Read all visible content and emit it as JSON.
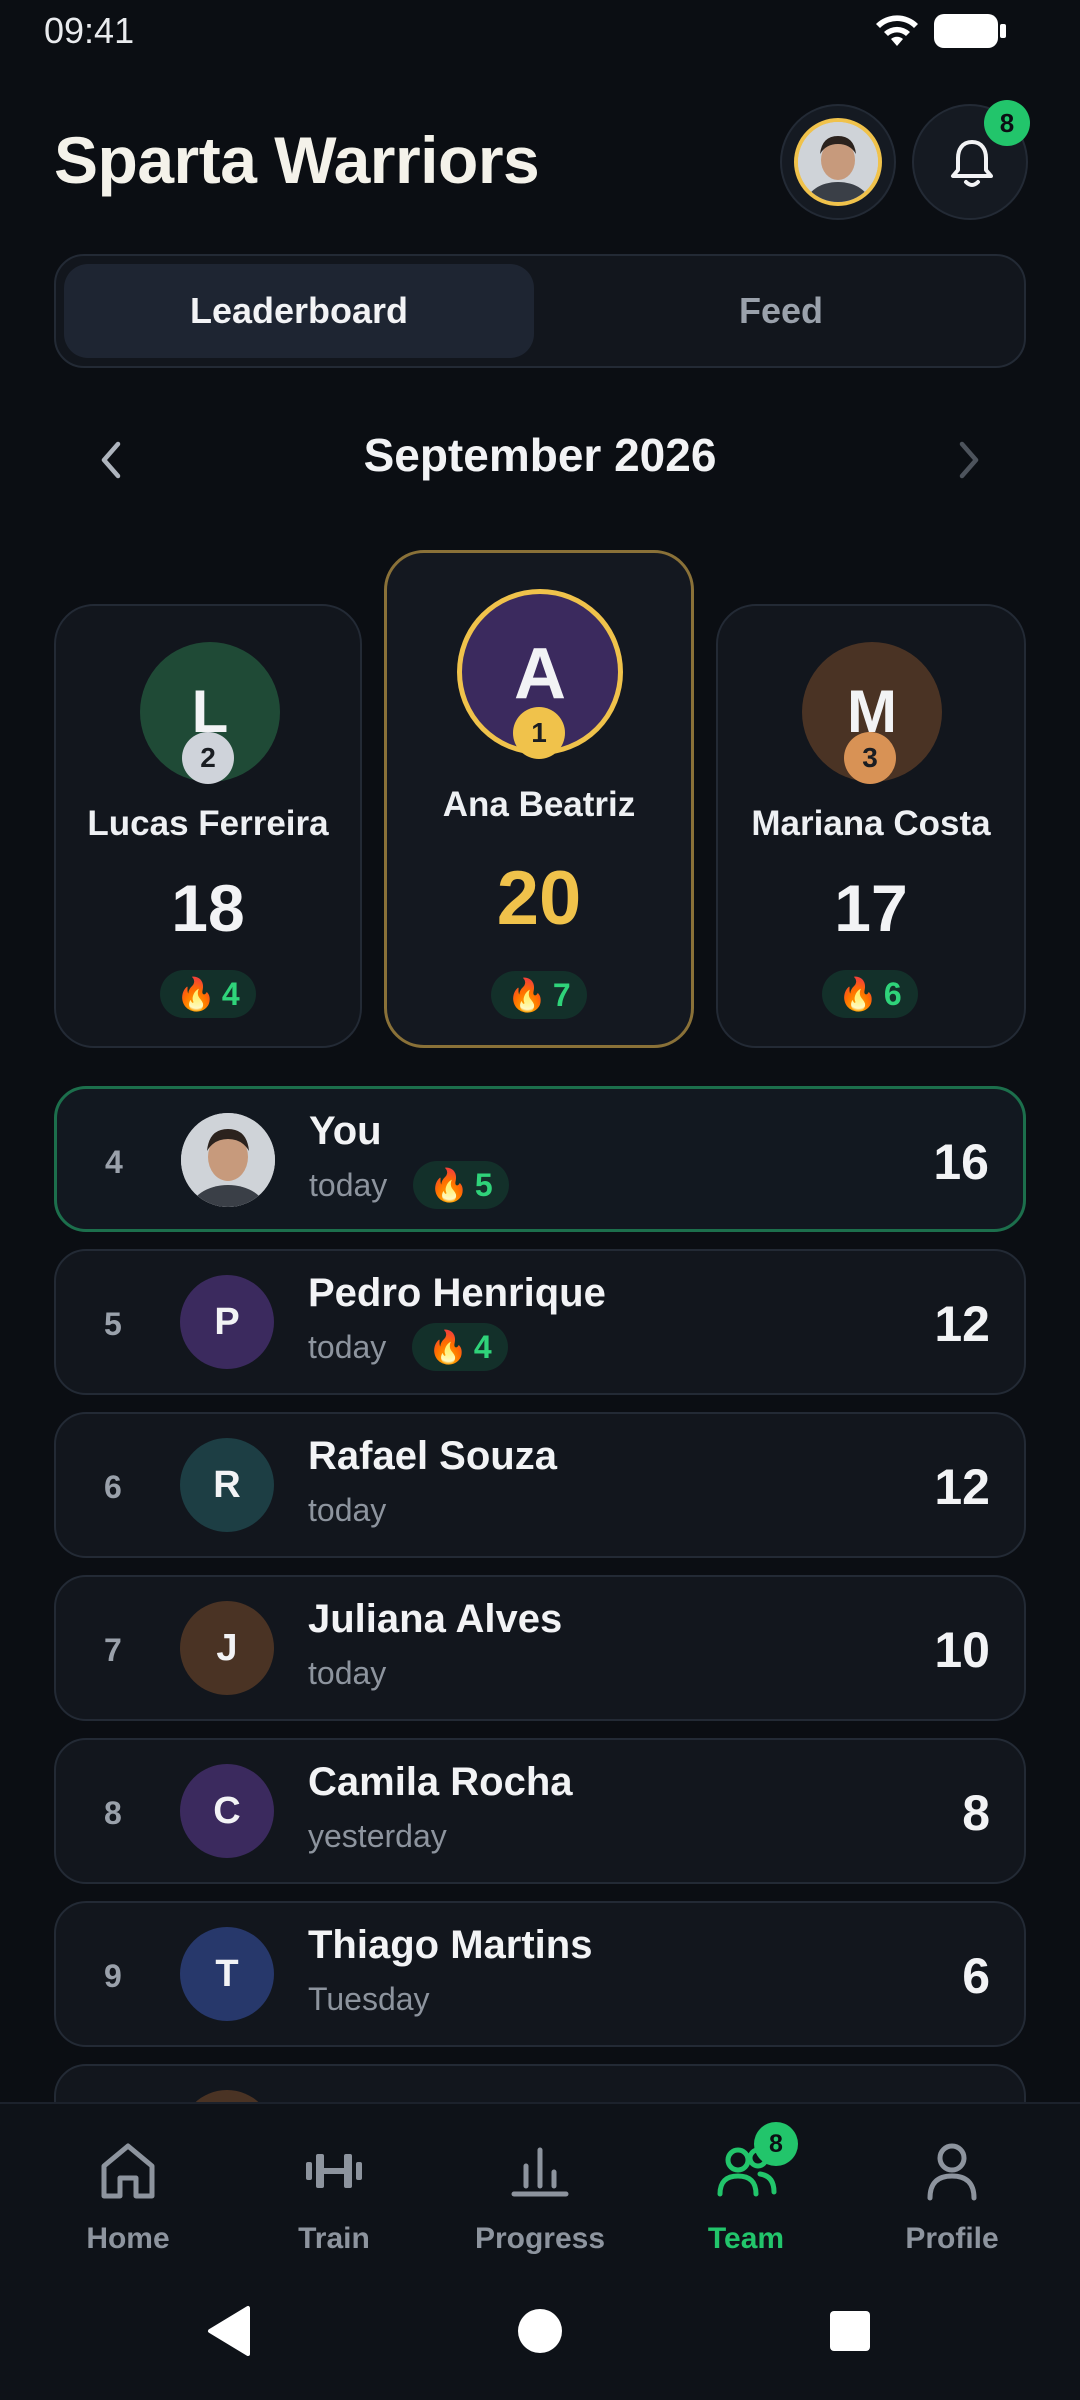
{
  "status": {
    "time": "09:41"
  },
  "header": {
    "title": "Sparta Warriors",
    "notification_count": "8"
  },
  "tabs": [
    {
      "label": "Leaderboard",
      "active": true
    },
    {
      "label": "Feed",
      "active": false
    }
  ],
  "month": {
    "label": "September 2026"
  },
  "podium": [
    {
      "rank": "2",
      "initial": "L",
      "name": "Lucas Ferreira",
      "score": "18",
      "streak": "4",
      "avatar_color": "#1f4a36",
      "chip_color": "#cfd3da"
    },
    {
      "rank": "1",
      "initial": "A",
      "name": "Ana Beatriz",
      "score": "20",
      "streak": "7",
      "avatar_color": "#3b2a5e",
      "chip_color": "#f0c24b"
    },
    {
      "rank": "3",
      "initial": "M",
      "name": "Mariana Costa",
      "score": "17",
      "streak": "6",
      "avatar_color": "#4a3324",
      "chip_color": "#d89255"
    }
  ],
  "list": [
    {
      "rank": "4",
      "name": "You",
      "sub": "today",
      "streak": "5",
      "score": "16",
      "initial": "",
      "avatar_color": "#cfd3d8"
    },
    {
      "rank": "5",
      "name": "Pedro Henrique",
      "sub": "today",
      "streak": "4",
      "score": "12",
      "initial": "P",
      "avatar_color": "#3b2a5e"
    },
    {
      "rank": "6",
      "name": "Rafael Souza",
      "sub": "today",
      "streak": "",
      "score": "12",
      "initial": "R",
      "avatar_color": "#1d3e44"
    },
    {
      "rank": "7",
      "name": "Juliana Alves",
      "sub": "today",
      "streak": "",
      "score": "10",
      "initial": "J",
      "avatar_color": "#4a3324"
    },
    {
      "rank": "8",
      "name": "Camila Rocha",
      "sub": "yesterday",
      "streak": "",
      "score": "8",
      "initial": "C",
      "avatar_color": "#3b2a5e"
    },
    {
      "rank": "9",
      "name": "Thiago Martins",
      "sub": "Tuesday",
      "streak": "",
      "score": "6",
      "initial": "T",
      "avatar_color": "#27386b"
    }
  ],
  "nav": [
    {
      "label": "Home",
      "icon": "home-icon",
      "active": false
    },
    {
      "label": "Train",
      "icon": "dumbbell-icon",
      "active": false
    },
    {
      "label": "Progress",
      "icon": "bar-chart-icon",
      "active": false
    },
    {
      "label": "Team",
      "icon": "team-icon",
      "active": true,
      "badge": "8"
    },
    {
      "label": "Profile",
      "icon": "profile-icon",
      "active": false
    }
  ],
  "colors": {
    "accent": "#22c56b",
    "gold": "#f0c24b",
    "background": "#0b0e13"
  }
}
